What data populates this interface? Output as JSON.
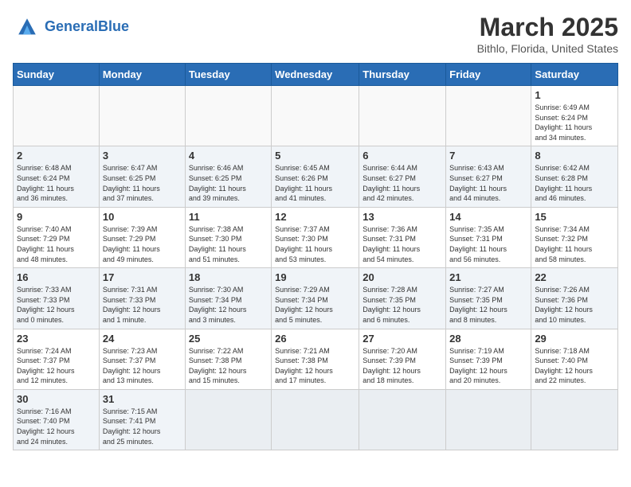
{
  "header": {
    "logo_general": "General",
    "logo_blue": "Blue",
    "title": "March 2025",
    "location": "Bithlo, Florida, United States"
  },
  "weekdays": [
    "Sunday",
    "Monday",
    "Tuesday",
    "Wednesday",
    "Thursday",
    "Friday",
    "Saturday"
  ],
  "weeks": [
    [
      {
        "day": "",
        "info": ""
      },
      {
        "day": "",
        "info": ""
      },
      {
        "day": "",
        "info": ""
      },
      {
        "day": "",
        "info": ""
      },
      {
        "day": "",
        "info": ""
      },
      {
        "day": "",
        "info": ""
      },
      {
        "day": "1",
        "info": "Sunrise: 6:49 AM\nSunset: 6:24 PM\nDaylight: 11 hours\nand 34 minutes."
      }
    ],
    [
      {
        "day": "2",
        "info": "Sunrise: 6:48 AM\nSunset: 6:24 PM\nDaylight: 11 hours\nand 36 minutes."
      },
      {
        "day": "3",
        "info": "Sunrise: 6:47 AM\nSunset: 6:25 PM\nDaylight: 11 hours\nand 37 minutes."
      },
      {
        "day": "4",
        "info": "Sunrise: 6:46 AM\nSunset: 6:25 PM\nDaylight: 11 hours\nand 39 minutes."
      },
      {
        "day": "5",
        "info": "Sunrise: 6:45 AM\nSunset: 6:26 PM\nDaylight: 11 hours\nand 41 minutes."
      },
      {
        "day": "6",
        "info": "Sunrise: 6:44 AM\nSunset: 6:27 PM\nDaylight: 11 hours\nand 42 minutes."
      },
      {
        "day": "7",
        "info": "Sunrise: 6:43 AM\nSunset: 6:27 PM\nDaylight: 11 hours\nand 44 minutes."
      },
      {
        "day": "8",
        "info": "Sunrise: 6:42 AM\nSunset: 6:28 PM\nDaylight: 11 hours\nand 46 minutes."
      }
    ],
    [
      {
        "day": "9",
        "info": "Sunrise: 7:40 AM\nSunset: 7:29 PM\nDaylight: 11 hours\nand 48 minutes."
      },
      {
        "day": "10",
        "info": "Sunrise: 7:39 AM\nSunset: 7:29 PM\nDaylight: 11 hours\nand 49 minutes."
      },
      {
        "day": "11",
        "info": "Sunrise: 7:38 AM\nSunset: 7:30 PM\nDaylight: 11 hours\nand 51 minutes."
      },
      {
        "day": "12",
        "info": "Sunrise: 7:37 AM\nSunset: 7:30 PM\nDaylight: 11 hours\nand 53 minutes."
      },
      {
        "day": "13",
        "info": "Sunrise: 7:36 AM\nSunset: 7:31 PM\nDaylight: 11 hours\nand 54 minutes."
      },
      {
        "day": "14",
        "info": "Sunrise: 7:35 AM\nSunset: 7:31 PM\nDaylight: 11 hours\nand 56 minutes."
      },
      {
        "day": "15",
        "info": "Sunrise: 7:34 AM\nSunset: 7:32 PM\nDaylight: 11 hours\nand 58 minutes."
      }
    ],
    [
      {
        "day": "16",
        "info": "Sunrise: 7:33 AM\nSunset: 7:33 PM\nDaylight: 12 hours\nand 0 minutes."
      },
      {
        "day": "17",
        "info": "Sunrise: 7:31 AM\nSunset: 7:33 PM\nDaylight: 12 hours\nand 1 minute."
      },
      {
        "day": "18",
        "info": "Sunrise: 7:30 AM\nSunset: 7:34 PM\nDaylight: 12 hours\nand 3 minutes."
      },
      {
        "day": "19",
        "info": "Sunrise: 7:29 AM\nSunset: 7:34 PM\nDaylight: 12 hours\nand 5 minutes."
      },
      {
        "day": "20",
        "info": "Sunrise: 7:28 AM\nSunset: 7:35 PM\nDaylight: 12 hours\nand 6 minutes."
      },
      {
        "day": "21",
        "info": "Sunrise: 7:27 AM\nSunset: 7:35 PM\nDaylight: 12 hours\nand 8 minutes."
      },
      {
        "day": "22",
        "info": "Sunrise: 7:26 AM\nSunset: 7:36 PM\nDaylight: 12 hours\nand 10 minutes."
      }
    ],
    [
      {
        "day": "23",
        "info": "Sunrise: 7:24 AM\nSunset: 7:37 PM\nDaylight: 12 hours\nand 12 minutes."
      },
      {
        "day": "24",
        "info": "Sunrise: 7:23 AM\nSunset: 7:37 PM\nDaylight: 12 hours\nand 13 minutes."
      },
      {
        "day": "25",
        "info": "Sunrise: 7:22 AM\nSunset: 7:38 PM\nDaylight: 12 hours\nand 15 minutes."
      },
      {
        "day": "26",
        "info": "Sunrise: 7:21 AM\nSunset: 7:38 PM\nDaylight: 12 hours\nand 17 minutes."
      },
      {
        "day": "27",
        "info": "Sunrise: 7:20 AM\nSunset: 7:39 PM\nDaylight: 12 hours\nand 18 minutes."
      },
      {
        "day": "28",
        "info": "Sunrise: 7:19 AM\nSunset: 7:39 PM\nDaylight: 12 hours\nand 20 minutes."
      },
      {
        "day": "29",
        "info": "Sunrise: 7:18 AM\nSunset: 7:40 PM\nDaylight: 12 hours\nand 22 minutes."
      }
    ],
    [
      {
        "day": "30",
        "info": "Sunrise: 7:16 AM\nSunset: 7:40 PM\nDaylight: 12 hours\nand 24 minutes."
      },
      {
        "day": "31",
        "info": "Sunrise: 7:15 AM\nSunset: 7:41 PM\nDaylight: 12 hours\nand 25 minutes."
      },
      {
        "day": "",
        "info": ""
      },
      {
        "day": "",
        "info": ""
      },
      {
        "day": "",
        "info": ""
      },
      {
        "day": "",
        "info": ""
      },
      {
        "day": "",
        "info": ""
      }
    ]
  ]
}
